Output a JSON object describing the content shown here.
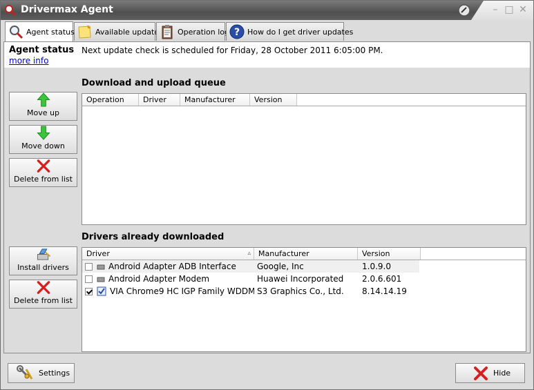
{
  "window": {
    "title": "Drivermax Agent"
  },
  "tabs": [
    {
      "label": "Agent status",
      "icon": "magnifier-icon"
    },
    {
      "label": "Available updates",
      "icon": "sticky-note-icon"
    },
    {
      "label": "Operation log",
      "icon": "clipboard-icon"
    },
    {
      "label": "How do I get driver updates",
      "icon": "help-icon"
    }
  ],
  "status": {
    "heading": "Agent status",
    "more_info": "more info",
    "schedule": "Next update check is scheduled for Friday, 28 October 2011 6:05:00 PM."
  },
  "queue": {
    "title": "Download and upload queue",
    "columns": [
      "Operation",
      "Driver",
      "Manufacturer",
      "Version"
    ],
    "rows": [],
    "buttons": {
      "move_up": "Move up",
      "move_down": "Move down",
      "delete": "Delete from list"
    }
  },
  "downloaded": {
    "title": "Drivers already downloaded",
    "columns": [
      "Driver",
      "Manufacturer",
      "Version"
    ],
    "rows": [
      {
        "checked": false,
        "driver": "Android Adapter ADB Interface",
        "manufacturer": "Google, Inc",
        "version": "1.0.9.0"
      },
      {
        "checked": false,
        "driver": "Android Adapter Modem",
        "manufacturer": "Huawei Incorporated",
        "version": "2.0.6.601"
      },
      {
        "checked": true,
        "driver": "VIA Chrome9 HC IGP Family WDDM",
        "manufacturer": "S3 Graphics Co., Ltd.",
        "version": "8.14.14.19"
      }
    ],
    "buttons": {
      "install": "Install drivers",
      "delete": "Delete from list"
    }
  },
  "footer": {
    "settings": "Settings",
    "hide": "Hide"
  },
  "colors": {
    "arrow_green": "#3cc43c",
    "delete_red": "#d42020",
    "link": "#0000cc"
  }
}
